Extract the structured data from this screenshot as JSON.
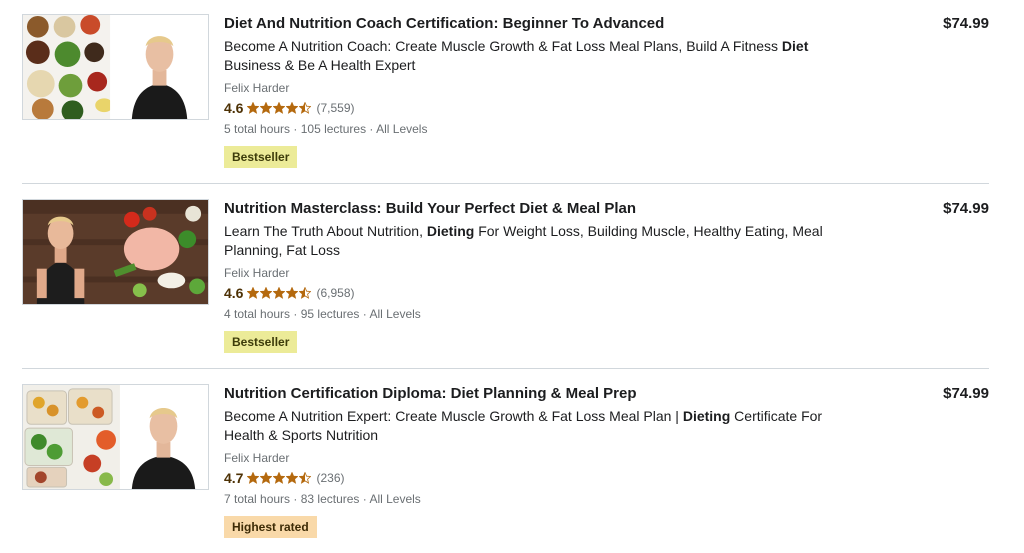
{
  "colors": {
    "star": "#b4690e",
    "bestseller_bg": "#eceb98",
    "highest_bg": "#f9d9a9",
    "divider": "#d1d7dc"
  },
  "courses": [
    {
      "title": "Diet And Nutrition Coach Certification: Beginner To Advanced",
      "headline_pre": "Become A Nutrition Coach: Create Muscle Growth & Fat Loss Meal Plans, Build A Fitness ",
      "headline_bold": "Diet",
      "headline_post": " Business & Be A Health Expert",
      "instructor": "Felix Harder",
      "rating": "4.6",
      "stars": 4.5,
      "reviews": "(7,559)",
      "hours": "5 total hours",
      "lectures": "105 lectures",
      "level": "All Levels",
      "badge": "Bestseller",
      "price": "$74.99"
    },
    {
      "title": "Nutrition Masterclass: Build Your Perfect Diet & Meal Plan",
      "headline_pre": "Learn The Truth About Nutrition, ",
      "headline_bold": "Dieting",
      "headline_post": " For Weight Loss, Building Muscle, Healthy Eating, Meal Planning, Fat Loss",
      "instructor": "Felix Harder",
      "rating": "4.6",
      "stars": 4.5,
      "reviews": "(6,958)",
      "hours": "4 total hours",
      "lectures": "95 lectures",
      "level": "All Levels",
      "badge": "Bestseller",
      "price": "$74.99"
    },
    {
      "title": "Nutrition Certification Diploma: Diet Planning & Meal Prep",
      "headline_pre": "Become A Nutrition Expert: Create Muscle Growth & Fat Loss Meal Plan | ",
      "headline_bold": "Dieting",
      "headline_post": " Certificate For Health & Sports Nutrition",
      "instructor": "Felix Harder",
      "rating": "4.7",
      "stars": 4.5,
      "reviews": "(236)",
      "hours": "7 total hours",
      "lectures": "83 lectures",
      "level": "All Levels",
      "badge": "Highest rated",
      "price": "$74.99"
    }
  ]
}
